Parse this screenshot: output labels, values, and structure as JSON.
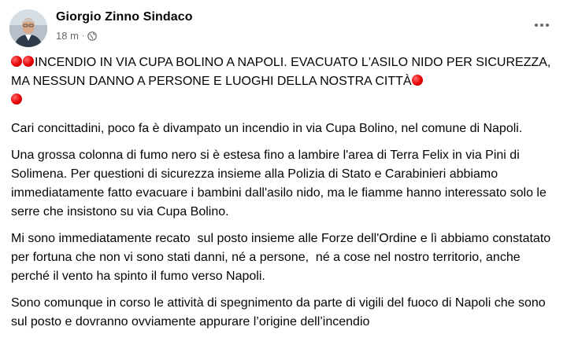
{
  "post": {
    "author": "Giorgio Zinno Sindaco",
    "timestamp": "18 m",
    "separator": "·",
    "privacy_icon": "globe-icon",
    "more_icon": "more-options-icon",
    "headline": "INCENDIO IN VIA CUPA BOLINO A NAPOLI. EVACUATO L'ASILO NIDO PER SICUREZZA, MA NESSUN DANNO A PERSONE E LUOGHI DELLA NOSTRA CITTÀ",
    "headline_emoji": "red-circle-emoji",
    "paragraphs": [
      "Cari concittadini, poco fa è divampato un incendio in via Cupa Bolino, nel comune di Napoli.",
      "Una grossa colonna di fumo nero si è estesa fino a lambire l'area di Terra Felix in via Pini di Solimena. Per questioni di sicurezza insieme alla Polizia di Stato e Carabinieri abbiamo immediatamente fatto evacuare i bambini dall'asilo nido, ma le fiamme hanno interessato solo le serre che insistono su via Cupa Bolino.",
      "Mi sono immediatamente recato  sul posto insieme alle Forze dell'Ordine e lì abbiamo constatato per fortuna che non vi sono stati danni, né a persone,  né a cose nel nostro territorio, anche perché il vento ha spinto il fumo verso Napoli.",
      "Sono comunque in corso le attività di spegnimento da parte di vigili del fuoco di Napoli che sono sul posto e dovranno ovviamente appurare l’origine dell’incendio"
    ]
  },
  "colors": {
    "text": "#050505",
    "secondary": "#65676b",
    "emoji_red": "#e60000"
  }
}
